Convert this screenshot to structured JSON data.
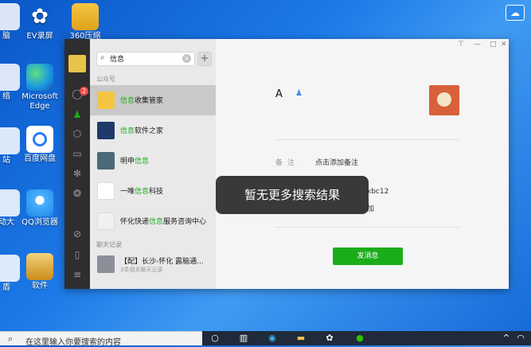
{
  "desktop": {
    "icons": [
      {
        "label": "脑"
      },
      {
        "label": "EV录屏"
      },
      {
        "label": "360压缩"
      },
      {
        "label": "络"
      },
      {
        "label": "Microsoft Edge"
      },
      {
        "label": "站"
      },
      {
        "label": "百度网盘"
      },
      {
        "label": "动大"
      },
      {
        "label": "QQ浏览器"
      },
      {
        "label": "盾"
      },
      {
        "label": "软件"
      }
    ]
  },
  "wechat": {
    "sidebar": {
      "badge": "2"
    },
    "search": {
      "value": "信息",
      "clear_icon": "×",
      "add_icon": "+"
    },
    "section_public": "公众号",
    "public_accounts": [
      {
        "pre": "",
        "hl": "信息",
        "post": "收集管家",
        "thumb_color": "#f4c542"
      },
      {
        "pre": "",
        "hl": "信息",
        "post": "软件之家",
        "thumb_color": "#1e3a6b"
      },
      {
        "pre": "明申",
        "hl": "信息",
        "post": "",
        "thumb_color": "#4a6a7a"
      },
      {
        "pre": "一唯",
        "hl": "信息",
        "post": "科技",
        "thumb_color": "#ffffff"
      },
      {
        "pre": "怀化快递",
        "hl": "信息",
        "post": "服务咨询中心",
        "thumb_color": "#f0f0f0"
      }
    ],
    "section_chat": "聊天记录",
    "chat_records": [
      {
        "title": "【配】长沙-怀化 露脑通...",
        "sub": "3条相关聊天记录"
      }
    ],
    "window_controls": {
      "pin": "⊤",
      "min": "—",
      "max": "□",
      "close": "✕"
    },
    "profile": {
      "name": "A",
      "remark_label": "备注",
      "remark_value": "点击添加备注",
      "partial_value_1": "kbc12",
      "partial_value_2": "加",
      "send_button": "发消息"
    },
    "toast": "暂无更多搜索结果"
  },
  "taskbar": {
    "search_placeholder": "在这里输入你要搜索的内容"
  }
}
